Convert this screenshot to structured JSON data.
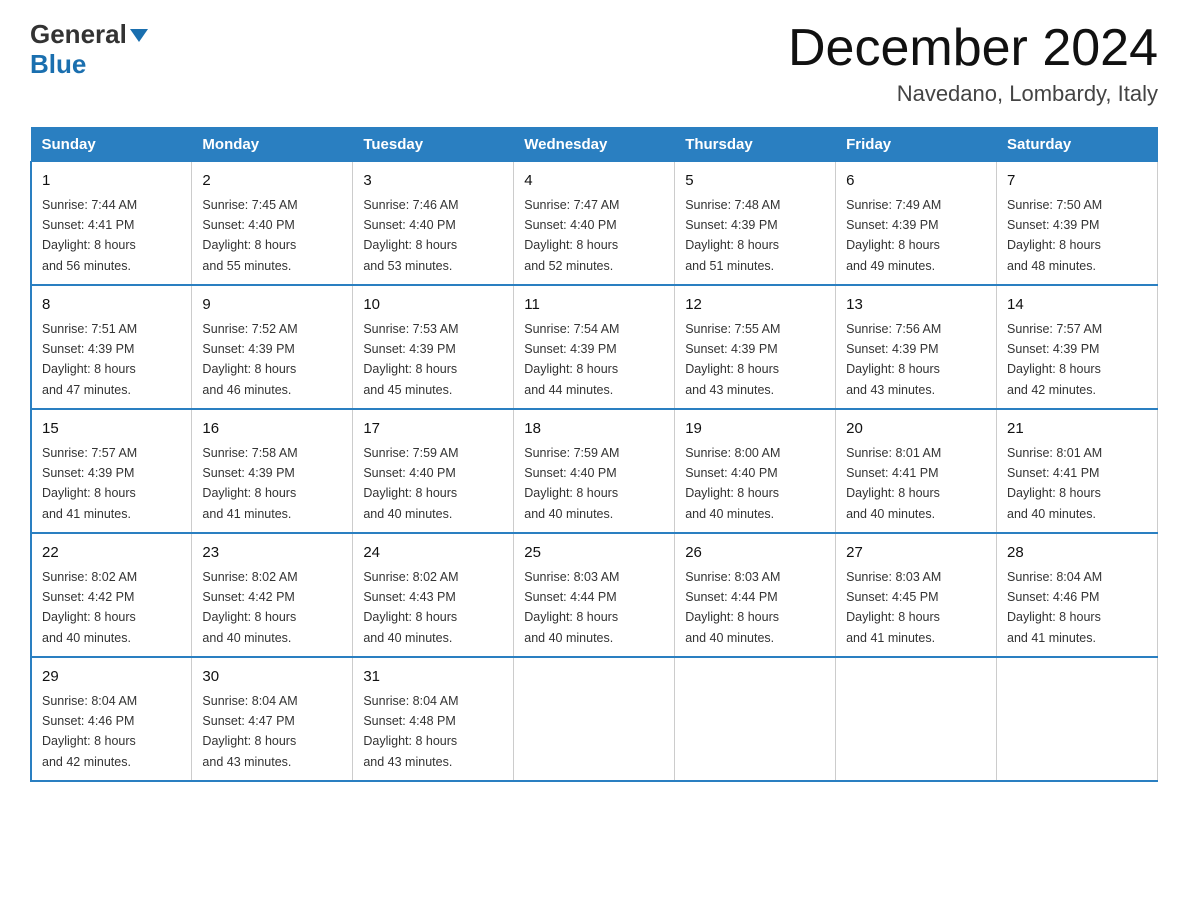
{
  "header": {
    "logo_general": "General",
    "logo_blue": "Blue",
    "month": "December 2024",
    "location": "Navedano, Lombardy, Italy"
  },
  "weekdays": [
    "Sunday",
    "Monday",
    "Tuesday",
    "Wednesday",
    "Thursday",
    "Friday",
    "Saturday"
  ],
  "weeks": [
    [
      {
        "day": "1",
        "sunrise": "7:44 AM",
        "sunset": "4:41 PM",
        "daylight": "8 hours and 56 minutes."
      },
      {
        "day": "2",
        "sunrise": "7:45 AM",
        "sunset": "4:40 PM",
        "daylight": "8 hours and 55 minutes."
      },
      {
        "day": "3",
        "sunrise": "7:46 AM",
        "sunset": "4:40 PM",
        "daylight": "8 hours and 53 minutes."
      },
      {
        "day": "4",
        "sunrise": "7:47 AM",
        "sunset": "4:40 PM",
        "daylight": "8 hours and 52 minutes."
      },
      {
        "day": "5",
        "sunrise": "7:48 AM",
        "sunset": "4:39 PM",
        "daylight": "8 hours and 51 minutes."
      },
      {
        "day": "6",
        "sunrise": "7:49 AM",
        "sunset": "4:39 PM",
        "daylight": "8 hours and 49 minutes."
      },
      {
        "day": "7",
        "sunrise": "7:50 AM",
        "sunset": "4:39 PM",
        "daylight": "8 hours and 48 minutes."
      }
    ],
    [
      {
        "day": "8",
        "sunrise": "7:51 AM",
        "sunset": "4:39 PM",
        "daylight": "8 hours and 47 minutes."
      },
      {
        "day": "9",
        "sunrise": "7:52 AM",
        "sunset": "4:39 PM",
        "daylight": "8 hours and 46 minutes."
      },
      {
        "day": "10",
        "sunrise": "7:53 AM",
        "sunset": "4:39 PM",
        "daylight": "8 hours and 45 minutes."
      },
      {
        "day": "11",
        "sunrise": "7:54 AM",
        "sunset": "4:39 PM",
        "daylight": "8 hours and 44 minutes."
      },
      {
        "day": "12",
        "sunrise": "7:55 AM",
        "sunset": "4:39 PM",
        "daylight": "8 hours and 43 minutes."
      },
      {
        "day": "13",
        "sunrise": "7:56 AM",
        "sunset": "4:39 PM",
        "daylight": "8 hours and 43 minutes."
      },
      {
        "day": "14",
        "sunrise": "7:57 AM",
        "sunset": "4:39 PM",
        "daylight": "8 hours and 42 minutes."
      }
    ],
    [
      {
        "day": "15",
        "sunrise": "7:57 AM",
        "sunset": "4:39 PM",
        "daylight": "8 hours and 41 minutes."
      },
      {
        "day": "16",
        "sunrise": "7:58 AM",
        "sunset": "4:39 PM",
        "daylight": "8 hours and 41 minutes."
      },
      {
        "day": "17",
        "sunrise": "7:59 AM",
        "sunset": "4:40 PM",
        "daylight": "8 hours and 40 minutes."
      },
      {
        "day": "18",
        "sunrise": "7:59 AM",
        "sunset": "4:40 PM",
        "daylight": "8 hours and 40 minutes."
      },
      {
        "day": "19",
        "sunrise": "8:00 AM",
        "sunset": "4:40 PM",
        "daylight": "8 hours and 40 minutes."
      },
      {
        "day": "20",
        "sunrise": "8:01 AM",
        "sunset": "4:41 PM",
        "daylight": "8 hours and 40 minutes."
      },
      {
        "day": "21",
        "sunrise": "8:01 AM",
        "sunset": "4:41 PM",
        "daylight": "8 hours and 40 minutes."
      }
    ],
    [
      {
        "day": "22",
        "sunrise": "8:02 AM",
        "sunset": "4:42 PM",
        "daylight": "8 hours and 40 minutes."
      },
      {
        "day": "23",
        "sunrise": "8:02 AM",
        "sunset": "4:42 PM",
        "daylight": "8 hours and 40 minutes."
      },
      {
        "day": "24",
        "sunrise": "8:02 AM",
        "sunset": "4:43 PM",
        "daylight": "8 hours and 40 minutes."
      },
      {
        "day": "25",
        "sunrise": "8:03 AM",
        "sunset": "4:44 PM",
        "daylight": "8 hours and 40 minutes."
      },
      {
        "day": "26",
        "sunrise": "8:03 AM",
        "sunset": "4:44 PM",
        "daylight": "8 hours and 40 minutes."
      },
      {
        "day": "27",
        "sunrise": "8:03 AM",
        "sunset": "4:45 PM",
        "daylight": "8 hours and 41 minutes."
      },
      {
        "day": "28",
        "sunrise": "8:04 AM",
        "sunset": "4:46 PM",
        "daylight": "8 hours and 41 minutes."
      }
    ],
    [
      {
        "day": "29",
        "sunrise": "8:04 AM",
        "sunset": "4:46 PM",
        "daylight": "8 hours and 42 minutes."
      },
      {
        "day": "30",
        "sunrise": "8:04 AM",
        "sunset": "4:47 PM",
        "daylight": "8 hours and 43 minutes."
      },
      {
        "day": "31",
        "sunrise": "8:04 AM",
        "sunset": "4:48 PM",
        "daylight": "8 hours and 43 minutes."
      },
      null,
      null,
      null,
      null
    ]
  ],
  "labels": {
    "sunrise": "Sunrise:",
    "sunset": "Sunset:",
    "daylight": "Daylight:"
  }
}
